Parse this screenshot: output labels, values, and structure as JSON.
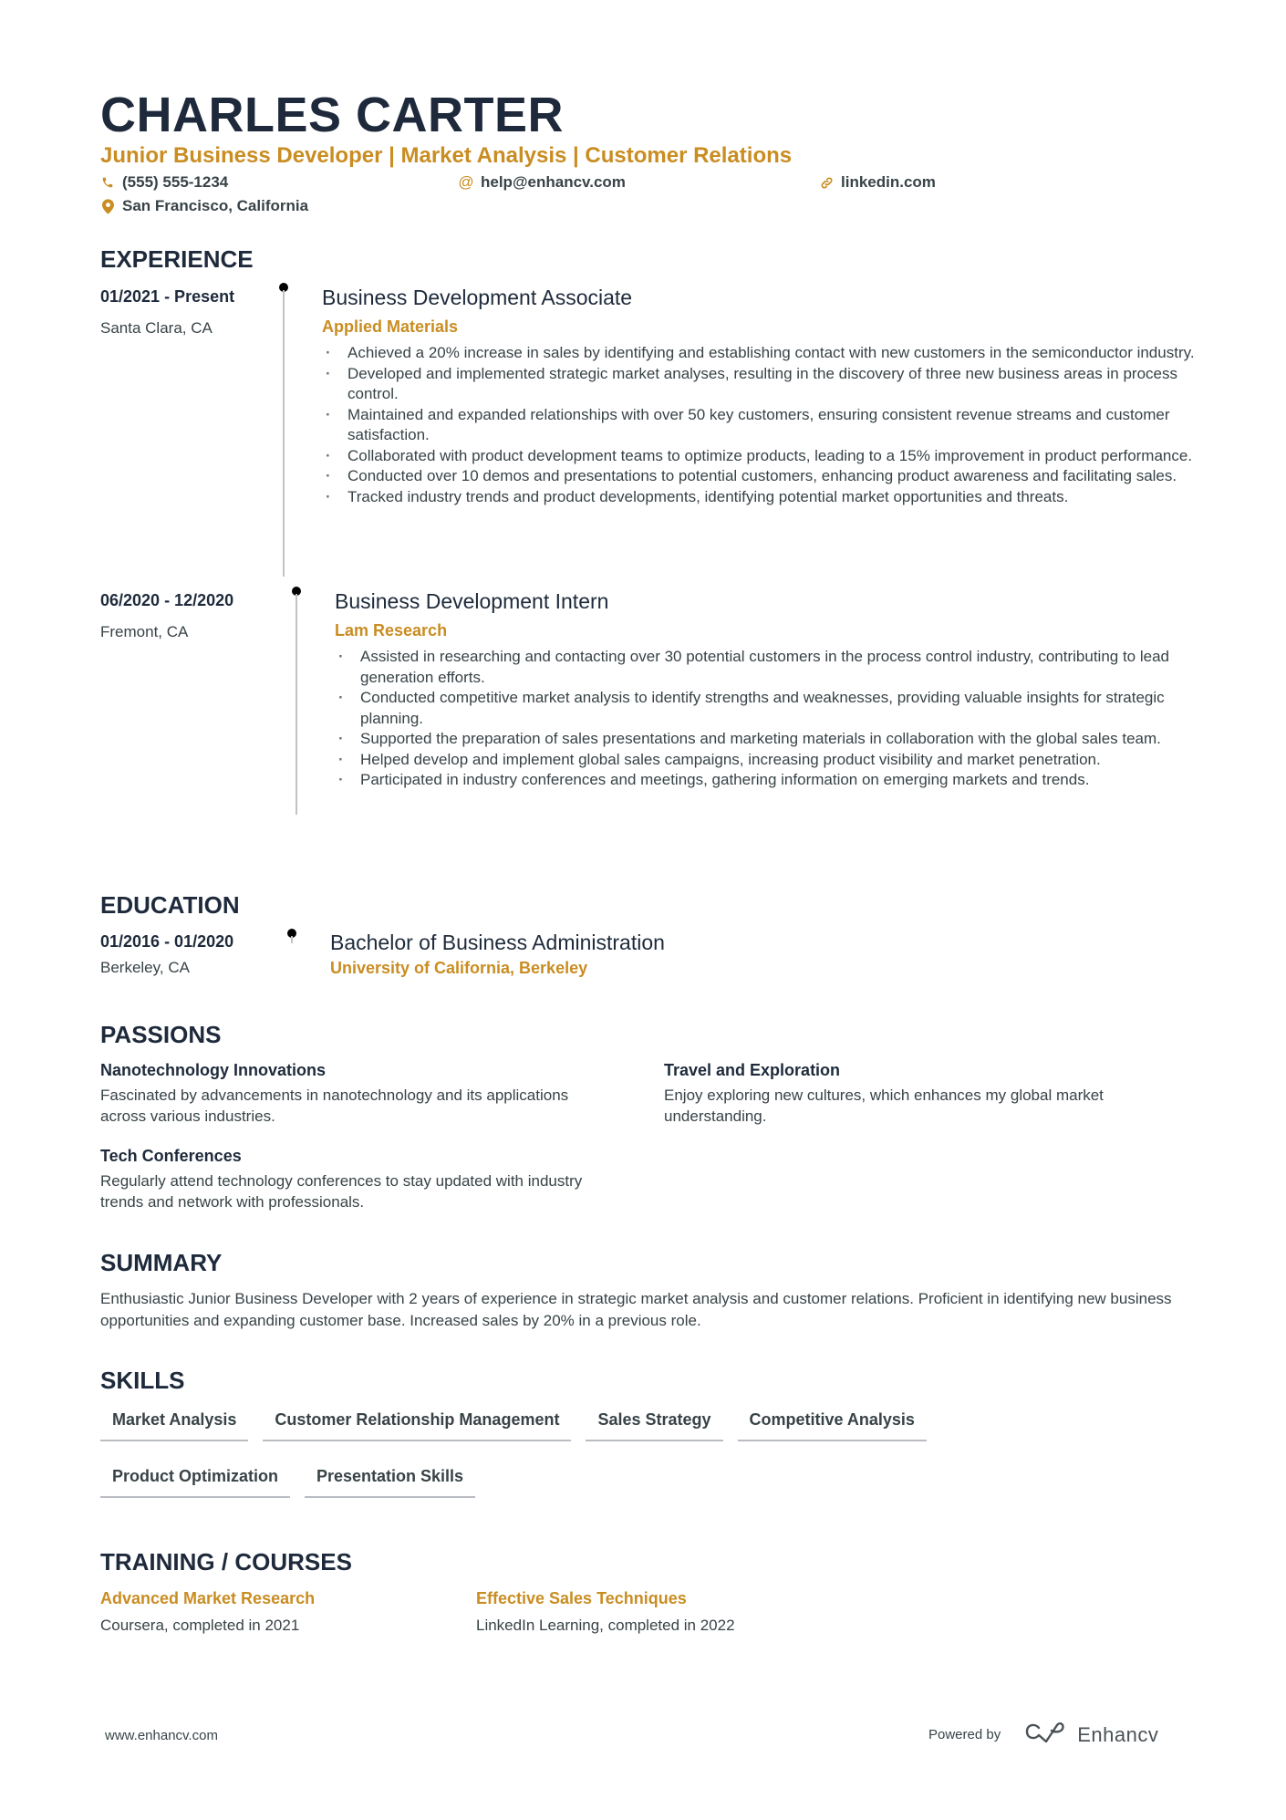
{
  "header": {
    "name": "CHARLES CARTER",
    "headline": "Junior Business Developer | Market Analysis | Customer Relations",
    "contacts": [
      {
        "icon": "phone-icon",
        "text": "(555) 555-1234"
      },
      {
        "icon": "at-icon",
        "text": "help@enhancv.com"
      },
      {
        "icon": "link-icon",
        "text": "linkedin.com"
      },
      {
        "icon": "location-pin-icon",
        "text": "San Francisco, California"
      }
    ]
  },
  "experience": {
    "title": "EXPERIENCE",
    "items": [
      {
        "dates": "01/2021 - Present",
        "location": "Santa Clara, CA",
        "role": "Business Development Associate",
        "company": "Applied Materials",
        "bullets": [
          "Achieved a 20% increase in sales by identifying and establishing contact with new customers in the semiconductor industry.",
          "Developed and implemented strategic market analyses, resulting in the discovery of three new business areas in process control.",
          "Maintained and expanded relationships with over 50 key customers, ensuring consistent revenue streams and customer satisfaction.",
          "Collaborated with product development teams to optimize products, leading to a 15% improvement in product performance.",
          "Conducted over 10 demos and presentations to potential customers, enhancing product awareness and facilitating sales.",
          "Tracked industry trends and product developments, identifying potential market opportunities and threats."
        ]
      },
      {
        "dates": "06/2020 - 12/2020",
        "location": "Fremont, CA",
        "role": "Business Development Intern",
        "company": "Lam Research",
        "bullets": [
          "Assisted in researching and contacting over 30 potential customers in the process control industry, contributing to lead generation efforts.",
          "Conducted competitive market analysis to identify strengths and weaknesses, providing valuable insights for strategic planning.",
          "Supported the preparation of sales presentations and marketing materials in collaboration with the global sales team.",
          "Helped develop and implement global sales campaigns, increasing product visibility and market penetration.",
          "Participated in industry conferences and meetings, gathering information on emerging markets and trends."
        ]
      }
    ]
  },
  "education": {
    "title": "EDUCATION",
    "items": [
      {
        "dates": "01/2016 - 01/2020",
        "location": "Berkeley, CA",
        "degree": "Bachelor of Business Administration",
        "school": "University of California, Berkeley"
      }
    ]
  },
  "passions": {
    "title": "PASSIONS",
    "items": [
      {
        "title": "Nanotechnology Innovations",
        "description": "Fascinated by advancements in nanotechnology and its applications across various industries."
      },
      {
        "title": "Travel and Exploration",
        "description": "Enjoy exploring new cultures, which enhances my global market understanding."
      },
      {
        "title": "Tech Conferences",
        "description": "Regularly attend technology conferences to stay updated with industry trends and network with professionals."
      }
    ]
  },
  "summary": {
    "title": "SUMMARY",
    "text": "Enthusiastic Junior Business Developer with 2 years of experience in strategic market analysis and customer relations. Proficient in identifying new business opportunities and expanding customer base. Increased sales by 20% in a previous role."
  },
  "skills": {
    "title": "SKILLS",
    "items": [
      "Market Analysis",
      "Customer Relationship Management",
      "Sales Strategy",
      "Competitive Analysis",
      "Product Optimization",
      "Presentation Skills"
    ]
  },
  "training": {
    "title": "TRAINING / COURSES",
    "items": [
      {
        "title": "Advanced Market Research",
        "description": "Coursera, completed in 2021"
      },
      {
        "title": "Effective Sales Techniques",
        "description": "LinkedIn Learning, completed in 2022"
      }
    ]
  },
  "footer": {
    "website": "www.enhancv.com",
    "powered_by": "Powered by",
    "brand": "Enhancv"
  },
  "colors": {
    "accent": "#c98d22",
    "heading": "#1e2a3b",
    "body": "#384347",
    "timeline": "#bfc3c7"
  }
}
